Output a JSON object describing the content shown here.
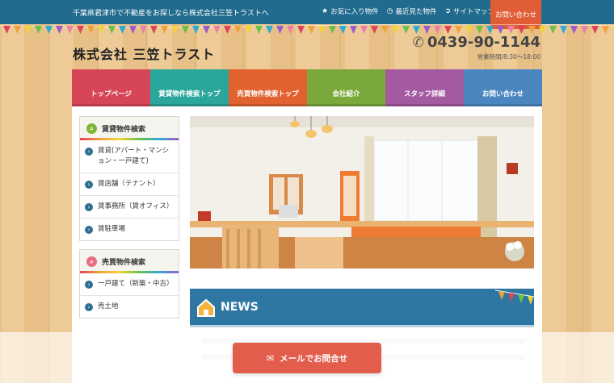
{
  "topbar": {
    "tagline": "千葉県君津市で不動産をお探しなら株式会社三笠トラストへ",
    "links": [
      {
        "icon": "star-icon",
        "glyph": "★",
        "label": "お気に入り物件"
      },
      {
        "icon": "clock-icon",
        "glyph": "◷",
        "label": "最近見た物件"
      },
      {
        "icon": "arrow-circle-icon",
        "glyph": "➲",
        "label": "サイトマップ"
      }
    ],
    "contact": "お問い合わせ"
  },
  "header": {
    "logo": "株式会社 三笠トラスト",
    "phone_icon": "phone-icon",
    "phone": "0439-90-1144",
    "hours": "営業時間/8:30～18:00"
  },
  "nav": [
    {
      "label": "トップページ",
      "color": "#d64558"
    },
    {
      "label": "賃貸物件検索トップ",
      "color": "#2aa69b"
    },
    {
      "label": "売買物件検索トップ",
      "color": "#e2622f"
    },
    {
      "label": "会社紹介",
      "color": "#7aa83a"
    },
    {
      "label": "スタッフ詳細",
      "color": "#a35aa0"
    },
    {
      "label": "お問い合わせ",
      "color": "#4a86c0"
    }
  ],
  "sidebar": {
    "rent": {
      "title": "賃貸物件検索",
      "icon": "search-icon",
      "items": [
        "賃貸(アパート・マンション・一戸建て)",
        "賃店舗（テナント）",
        "賃事務所（賃オフィス）",
        "賃駐車場"
      ]
    },
    "sale": {
      "title": "売買物件検索",
      "icon": "search-icon",
      "items": [
        "一戸建て（新築・中古）",
        "売土地"
      ]
    }
  },
  "news": {
    "title": "NEWS",
    "icon": "house-icon"
  },
  "cta": {
    "icon": "envelope-icon",
    "label": "メールでお問合せ"
  },
  "colors": {
    "topbar": "#216b8e",
    "contact_tab": "#e05d35",
    "cta": "#e35d4c",
    "news": "#2f77a3"
  }
}
